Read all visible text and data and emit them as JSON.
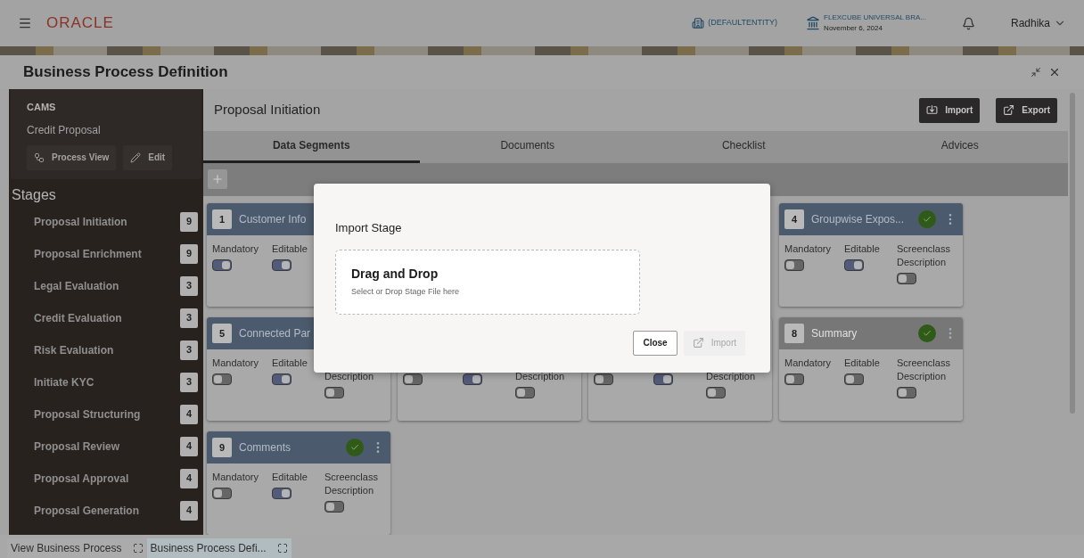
{
  "header": {
    "logo": "ORACLE",
    "entity": "(DEFAULTENTITY)",
    "branch": "FLEXCUBE UNIVERSAL BRA...",
    "date": "November 6, 2024",
    "user": "Radhika"
  },
  "window": {
    "title": "Business Process Definition"
  },
  "sidebar": {
    "product": "CAMS",
    "process": "Credit Proposal",
    "buttons": [
      "Process View",
      "Edit"
    ],
    "stages_title": "Stages",
    "stages": [
      {
        "name": "Proposal Initiation",
        "count": "9"
      },
      {
        "name": "Proposal Enrichment",
        "count": "9"
      },
      {
        "name": "Legal Evaluation",
        "count": "3"
      },
      {
        "name": "Credit Evaluation",
        "count": "3"
      },
      {
        "name": "Risk Evaluation",
        "count": "3"
      },
      {
        "name": "Initiate KYC",
        "count": "3"
      },
      {
        "name": "Proposal Structuring",
        "count": "4"
      },
      {
        "name": "Proposal Review",
        "count": "4"
      },
      {
        "name": "Proposal Approval",
        "count": "4"
      },
      {
        "name": "Proposal Generation",
        "count": "4"
      }
    ]
  },
  "stage": {
    "title": "Proposal Initiation",
    "actions": [
      "Import",
      "Export"
    ],
    "tabs": [
      {
        "label": "Data Segments",
        "selected": true
      },
      {
        "label": "Documents",
        "selected": false
      },
      {
        "label": "Checklist",
        "selected": false
      },
      {
        "label": "Advices",
        "selected": false
      }
    ],
    "card_rows": [
      [
        {
          "number": "1",
          "title": "Customer Info",
          "active": true,
          "fields": [
            {
              "label": "Mandatory",
              "on": true
            },
            {
              "label": "Editable",
              "on": true
            }
          ]
        },
        {
          "number": "4",
          "title": "Groupwise Expos...",
          "active": true,
          "checked": true,
          "fields": [
            {
              "label": "Mandatory",
              "on": false
            },
            {
              "label": "Editable",
              "on": true
            },
            {
              "label": "Screenclass Description",
              "on": false
            }
          ]
        }
      ],
      [
        {
          "number": "5",
          "title": "Connected Par",
          "active": true,
          "fields": [
            {
              "label": "Mandatory",
              "on": false
            },
            {
              "label": "Editable",
              "on": true
            },
            {
              "label": "Description",
              "on": false
            }
          ]
        },
        {
          "fields": [
            {
              "on": false
            },
            {
              "on": true
            },
            {
              "label": "Description",
              "on": false
            }
          ]
        },
        {
          "fields": [
            {
              "on": false
            },
            {
              "on": true
            },
            {
              "label": "Description",
              "on": false
            }
          ]
        },
        {
          "number": "8",
          "title": "Summary",
          "active": false,
          "checked": true,
          "fields": [
            {
              "label": "Mandatory",
              "on": false
            },
            {
              "label": "Editable",
              "on": false
            },
            {
              "label": "Screenclass Description",
              "on": false
            }
          ]
        }
      ],
      [
        {
          "number": "9",
          "title": "Comments",
          "active": true,
          "checked": true,
          "fields": [
            {
              "label": "Mandatory",
              "on": false
            },
            {
              "label": "Editable",
              "on": true
            },
            {
              "label": "Screenclass Description",
              "on": false
            }
          ]
        }
      ]
    ]
  },
  "dialog": {
    "title": "Import Stage",
    "drop_title": "Drag and Drop",
    "drop_hint": "Select or Drop Stage File here",
    "buttons": [
      {
        "label": "Close",
        "disabled": false
      },
      {
        "label": "Import",
        "disabled": true
      }
    ]
  },
  "taskbar": [
    {
      "label": "View Business Process",
      "selected": false
    },
    {
      "label": "Business Process Defi...",
      "selected": true
    }
  ]
}
